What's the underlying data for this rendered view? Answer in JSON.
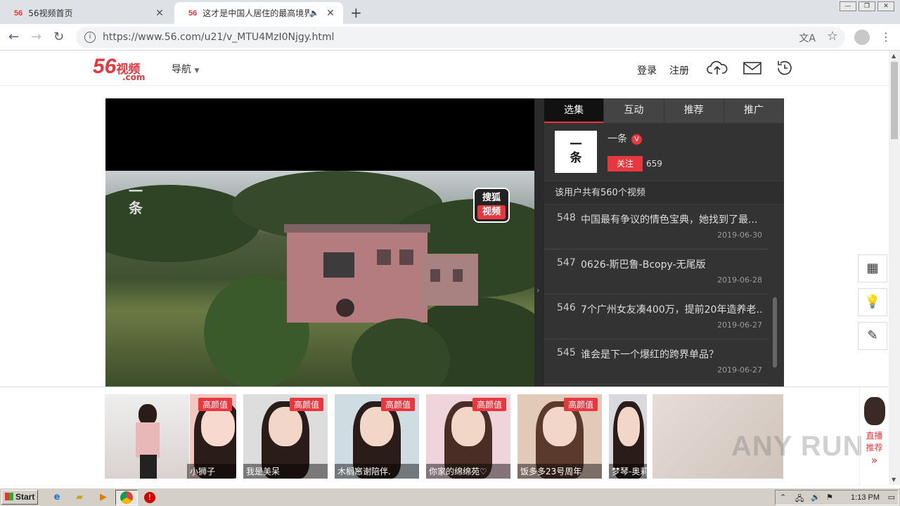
{
  "browser": {
    "tabs": [
      {
        "favicon": "56",
        "title": "56视频首页",
        "active": false
      },
      {
        "favicon": "56",
        "title": "这才是中国人居住的最高境界",
        "active": true
      }
    ],
    "url": "https://www.56.com/u21/v_MTU4MzI0Njgy.html"
  },
  "site": {
    "logo_num": "56",
    "logo_cn": "视频",
    "logo_com": ".com",
    "nav_label": "导航",
    "login": "登录",
    "register": "注册"
  },
  "player": {
    "watermark_left": "一条",
    "watermark_right_top": "搜狐",
    "watermark_right_bottom": "视频"
  },
  "panel": {
    "tabs": [
      "选集",
      "互动",
      "推荐",
      "推广"
    ],
    "active_tab": 0,
    "author_avatar_text": "一条",
    "author_name": "一条",
    "verified_mark": "V",
    "follow_label": "关注",
    "follow_count": "659",
    "total_text": "该用户共有560个视频",
    "videos": [
      {
        "num": "548",
        "title": "中国最有争议的情色宝典，她找到了最...",
        "date": "2019-06-30"
      },
      {
        "num": "547",
        "title": "0626-斯巴鲁-Bcopy-无尾版",
        "date": "2019-06-28"
      },
      {
        "num": "546",
        "title": "7个广州女友凑400万，提前20年造养老...",
        "date": "2019-06-27"
      },
      {
        "num": "545",
        "title": "谁会是下一个爆红的跨界单品？",
        "date": "2019-06-27"
      }
    ]
  },
  "float_tools": [
    "qr-code-icon",
    "lightbulb-icon",
    "edit-icon"
  ],
  "live": {
    "badge": "高颜值",
    "cards": [
      {
        "name": "小狮子"
      },
      {
        "name": "我是美呆"
      },
      {
        "name": "木榈窸谢陪伴."
      },
      {
        "name": "你家的绵绵苑♡"
      },
      {
        "name": "饭多多23号周年"
      },
      {
        "name": "梦琴-奥莉"
      }
    ],
    "side_label_1": "直播",
    "side_label_2": "推荐",
    "side_arrow": "»",
    "watermark": "ANY RUN"
  },
  "taskbar": {
    "start_label": "Start",
    "clock": "1:13 PM"
  },
  "colors": {
    "brand_red": "#e8373e",
    "panel_bg": "#333333"
  }
}
